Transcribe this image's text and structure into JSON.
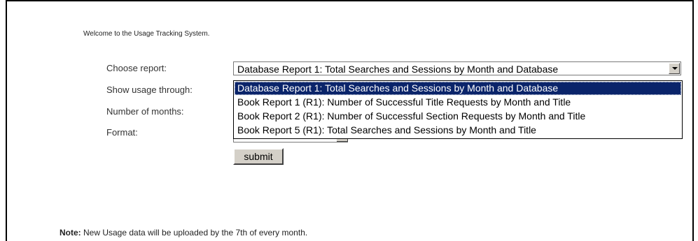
{
  "page": {
    "welcome": "Welcome to the Usage Tracking System."
  },
  "form": {
    "labels": {
      "choose_report": "Choose report:",
      "show_usage_through": "Show usage through:",
      "number_of_months": "Number of months:",
      "format": "Format:"
    },
    "report_select": {
      "selected": "Database Report 1: Total Searches and Sessions by Month and Database",
      "options": [
        "Database Report 1: Total Searches and Sessions by Month and Database",
        "Book Report 1 (R1): Number of Successful Title Requests by Month and Title",
        "Book Report 2 (R1): Number of Successful Section Requests by Month and Title",
        "Book Report 5 (R1): Total Searches and Sessions by Month and Title"
      ],
      "highlighted_index": 0
    },
    "submit_label": "submit"
  },
  "note": {
    "prefix": "Note:",
    "text": " New Usage data will be uploaded by the 7th of every month."
  },
  "colors": {
    "highlight_bg": "#0a246a",
    "button_face": "#d4d0c8",
    "heading_gold": "#c9a53a"
  },
  "icons": {
    "dropdown_arrow": "chevron-down-icon"
  }
}
